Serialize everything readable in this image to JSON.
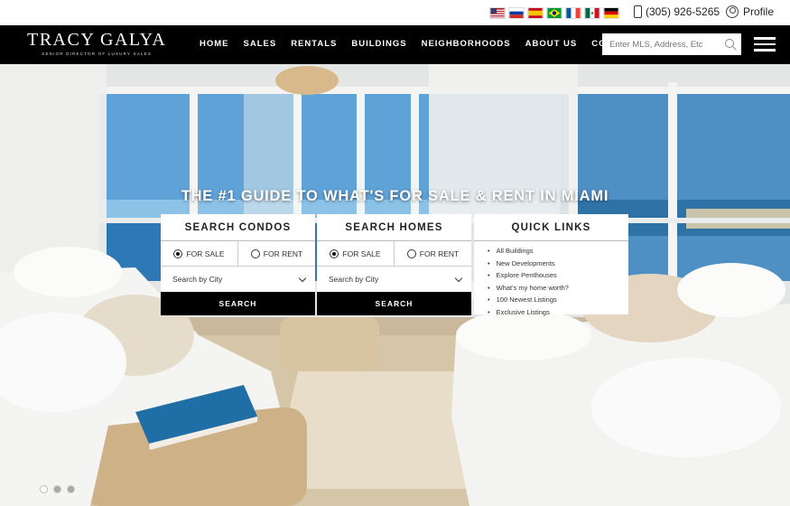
{
  "topbar": {
    "flags": [
      {
        "name": "us-flag-icon",
        "colors": [
          "#b22234",
          "#ffffff",
          "#3c3b6e"
        ]
      },
      {
        "name": "russia-flag-icon",
        "colors": [
          "#ffffff",
          "#0039a6",
          "#d52b1e"
        ]
      },
      {
        "name": "spain-flag-icon",
        "colors": [
          "#c60b1e",
          "#ffc400",
          "#c60b1e"
        ]
      },
      {
        "name": "brazil-flag-icon",
        "colors": [
          "#009c3b",
          "#ffdf00",
          "#002776"
        ]
      },
      {
        "name": "france-flag-icon",
        "colors": [
          "#0055a4",
          "#ffffff",
          "#ef4135"
        ]
      },
      {
        "name": "mexico-flag-icon",
        "colors": [
          "#006847",
          "#ffffff",
          "#ce1126"
        ]
      },
      {
        "name": "germany-flag-icon",
        "colors": [
          "#000000",
          "#dd0000",
          "#ffce00"
        ]
      }
    ],
    "phone": "(305) 926-5265",
    "profile": "Profile"
  },
  "nav": {
    "logo_main": "TRACY GALYA",
    "logo_sub": "SENIOR DIRECTOR OF LUXURY SALES",
    "links": [
      "HOME",
      "SALES",
      "RENTALS",
      "BUILDINGS",
      "NEIGHBORHOODS",
      "ABOUT US",
      "CONTACT"
    ],
    "search_placeholder": "Enter MLS, Address, Etc"
  },
  "hero": {
    "headline": "THE #1 GUIDE TO WHAT'S FOR SALE & RENT IN MIAMI",
    "condos": {
      "title": "SEARCH CONDOS",
      "for_sale": "FOR SALE",
      "for_rent": "FOR RENT",
      "selected": "FOR SALE",
      "select_value": "Search by City",
      "button": "SEARCH"
    },
    "homes": {
      "title": "SEARCH HOMES",
      "for_sale": "FOR SALE",
      "for_rent": "FOR RENT",
      "selected": "FOR SALE",
      "select_value": "Search by City",
      "button": "SEARCH"
    },
    "quick_links": {
      "title": "QUICK LINKS",
      "items": [
        "All Buildings",
        "New Developments",
        "Explore Penthouses",
        "What's my home worth?",
        "100 Newest Listings",
        "Exclusive Listings"
      ]
    },
    "slider": {
      "slides": 3,
      "active": 1
    }
  }
}
